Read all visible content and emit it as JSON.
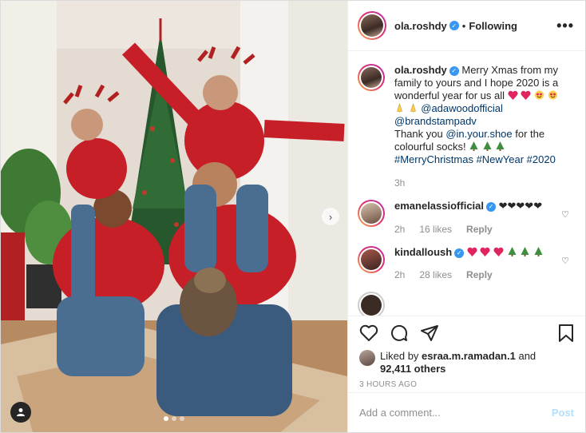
{
  "post": {
    "username": "ola.roshdy",
    "following_label": "Following",
    "more_label": "•••"
  },
  "caption": {
    "username": "ola.roshdy",
    "text1": "Merry Xmas from my family to yours and I hope 2020 is a wonderful year for us all",
    "mention1": "@adawoodofficial",
    "mention2": "@brandstampadv",
    "text2": "Thank you",
    "mention3": "@in.your.shoe",
    "text3": "for the colourful socks!",
    "hashtags": "#MerryChristmas #NewYear #2020",
    "time": "3h"
  },
  "comments": [
    {
      "username": "emanelassiofficial",
      "text": "❤❤❤❤❤",
      "time": "2h",
      "likes": "16 likes",
      "reply": "Reply"
    },
    {
      "username": "kindalloush",
      "time": "2h",
      "likes": "28 likes",
      "reply": "Reply"
    }
  ],
  "likes": {
    "prefix": "Liked by",
    "user": "esraa.m.ramadan.1",
    "joiner": "and",
    "others": "92,411 others"
  },
  "timestamp": "3 HOURS AGO",
  "add_comment": {
    "placeholder": "Add a comment...",
    "post_label": "Post"
  },
  "colors": {
    "verified": "#3897f0",
    "link": "#00376b",
    "post_disabled": "#b2dffc",
    "heart_emoji": "#e0245e"
  }
}
